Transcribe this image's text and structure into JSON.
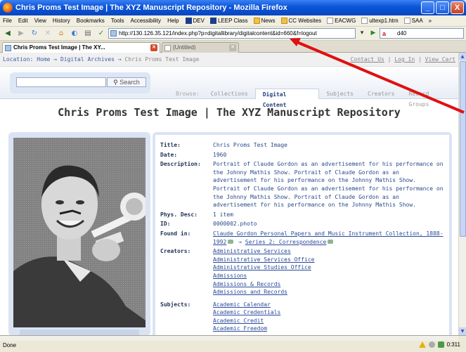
{
  "window": {
    "title": "Chris Proms Test Image | The XYZ Manuscript Repository - Mozilla Firefox",
    "minimize": "_",
    "maximize": "□",
    "close": "X"
  },
  "menubar": {
    "items": [
      "File",
      "Edit",
      "View",
      "History",
      "Bookmarks",
      "Tools",
      "Accessibility",
      "Help"
    ],
    "bookmarks": [
      "DEV",
      "LEEP Class",
      "News",
      "CC Websites",
      "EACWG",
      "ultexp1.htm",
      "SAA"
    ],
    "overflow": "»"
  },
  "navbar": {
    "url": "http://130.126.35.121/index.php?p=digitallibrary/digitalcontent&id=660&f=logout",
    "search_value": "d40",
    "search_engine_glyph": "a"
  },
  "tabs": [
    {
      "label": "Chris Proms Test Image | The XY...",
      "active": true
    },
    {
      "label": "(Untitled)",
      "active": false
    }
  ],
  "page": {
    "location_label": "Location:",
    "breadcrumb": [
      "Home",
      "Digital Archives",
      "Chris Proms Test Image"
    ],
    "crumb_sep": "→",
    "top_links": [
      "Contact Us",
      "Log In",
      "View Cart"
    ],
    "top_links_sep": "|",
    "search_button": "Search",
    "browse_label": "Browse:",
    "nav_tabs": [
      "Collections",
      "Digital Content",
      "Subjects",
      "Creators",
      "Record Groups"
    ],
    "nav_active": "Digital Content",
    "title": "Chris Proms Test Image | The XYZ Manuscript Repository"
  },
  "metadata": {
    "title_label": "Title:",
    "title": "Chris Proms Test Image",
    "date_label": "Date:",
    "date": "1960",
    "description_label": "Description:",
    "description": "Portrait of Claude Gordon as an advertisement for his performance on the Johnny Mathis Show. Portrait of Claude Gordon as an advertisement for his performance on the Johnny Mathis Show. Portrait of Claude Gordon as an advertisement for his performance on the Johnny Mathis Show. Portrait of Claude Gordon as an advertisement for his performance on the Johnny Mathis Show.",
    "phys_label": "Phys. Desc:",
    "phys": "1 item",
    "id_label": "ID:",
    "id": "0000002.photo",
    "found_label": "Found in:",
    "found_collection": "Claude Gordon Personal Papers and Music Instrument Collection, 1888-1992",
    "found_arrow": "→",
    "found_series": "Series 2: Correspondence",
    "creators_label": "Creators:",
    "creators": [
      "Administrative Services",
      "Administrative Services Office",
      "Administrative Studies Office",
      "Admissions",
      "Admissions & Records",
      "Admissions and Records"
    ],
    "subjects_label": "Subjects:",
    "subjects": [
      "Academic Calendar",
      "Academic Credentials",
      "Academic Credit",
      "Academic Freedom"
    ]
  },
  "status": {
    "text": "Done",
    "right": "0:311"
  },
  "colors": {
    "titlebar": "#0a55d8",
    "link": "#2a4a9a",
    "label": "#1f2f55",
    "panel": "#dbe3f3",
    "annotation_arrow": "#e01010"
  }
}
